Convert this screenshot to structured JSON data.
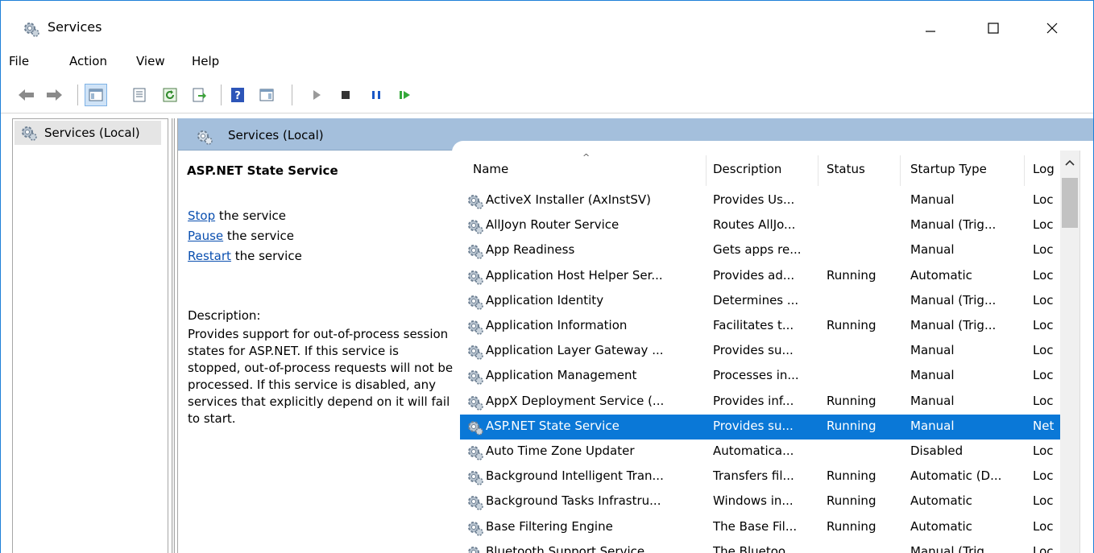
{
  "window": {
    "title": "Services"
  },
  "menu": [
    "File",
    "Action",
    "View",
    "Help"
  ],
  "toolbar": {
    "icons": [
      "back-icon",
      "forward-icon",
      "show-hide-console-tree-icon",
      "properties-icon",
      "refresh-icon",
      "export-list-icon",
      "help-icon",
      "show-action-pane-icon",
      "start-service-icon",
      "stop-service-icon",
      "pause-service-icon",
      "resume-service-icon"
    ]
  },
  "tree": {
    "item": "Services (Local)"
  },
  "content": {
    "header": "Services (Local)",
    "selected_name": "ASP.NET State Service",
    "actions": [
      {
        "link": "Stop",
        "rest": " the service"
      },
      {
        "link": "Pause",
        "rest": " the service"
      },
      {
        "link": "Restart",
        "rest": " the service"
      }
    ],
    "description_label": "Description:",
    "description": "Provides support for out-of-process session states for ASP.NET. If this service is stopped, out-of-process requests will not be processed. If this service is disabled, any services that explicitly depend on it will fail to start."
  },
  "columns": {
    "name": "Name",
    "description": "Description",
    "status": "Status",
    "startup": "Startup Type",
    "logon": "Log"
  },
  "rows": [
    {
      "name": "ActiveX Installer (AxInstSV)",
      "description": "Provides Us...",
      "status": "",
      "startup": "Manual",
      "logon": "Loc"
    },
    {
      "name": "AllJoyn Router Service",
      "description": "Routes AllJo...",
      "status": "",
      "startup": "Manual (Trig...",
      "logon": "Loc"
    },
    {
      "name": "App Readiness",
      "description": "Gets apps re...",
      "status": "",
      "startup": "Manual",
      "logon": "Loc"
    },
    {
      "name": "Application Host Helper Ser...",
      "description": "Provides ad...",
      "status": "Running",
      "startup": "Automatic",
      "logon": "Loc"
    },
    {
      "name": "Application Identity",
      "description": "Determines ...",
      "status": "",
      "startup": "Manual (Trig...",
      "logon": "Loc"
    },
    {
      "name": "Application Information",
      "description": "Facilitates t...",
      "status": "Running",
      "startup": "Manual (Trig...",
      "logon": "Loc"
    },
    {
      "name": "Application Layer Gateway ...",
      "description": "Provides su...",
      "status": "",
      "startup": "Manual",
      "logon": "Loc"
    },
    {
      "name": "Application Management",
      "description": "Processes in...",
      "status": "",
      "startup": "Manual",
      "logon": "Loc"
    },
    {
      "name": "AppX Deployment Service (...",
      "description": "Provides inf...",
      "status": "Running",
      "startup": "Manual",
      "logon": "Loc"
    },
    {
      "name": "ASP.NET State Service",
      "description": "Provides su...",
      "status": "Running",
      "startup": "Manual",
      "logon": "Net",
      "selected": true
    },
    {
      "name": "Auto Time Zone Updater",
      "description": "Automatica...",
      "status": "",
      "startup": "Disabled",
      "logon": "Loc"
    },
    {
      "name": "Background Intelligent Tran...",
      "description": "Transfers fil...",
      "status": "Running",
      "startup": "Automatic (D...",
      "logon": "Loc"
    },
    {
      "name": "Background Tasks Infrastru...",
      "description": "Windows in...",
      "status": "Running",
      "startup": "Automatic",
      "logon": "Loc"
    },
    {
      "name": "Base Filtering Engine",
      "description": "The Base Fil...",
      "status": "Running",
      "startup": "Automatic",
      "logon": "Loc"
    },
    {
      "name": "Bluetooth Support Service",
      "description": "The Bluetoo...",
      "status": "",
      "startup": "Manual (Trig...",
      "logon": "Loc"
    }
  ],
  "colors": {
    "selection": "#0a78d7",
    "header_band": "#a4bfdc",
    "link": "#0a4fb0",
    "window_border": "#1e80d8"
  }
}
